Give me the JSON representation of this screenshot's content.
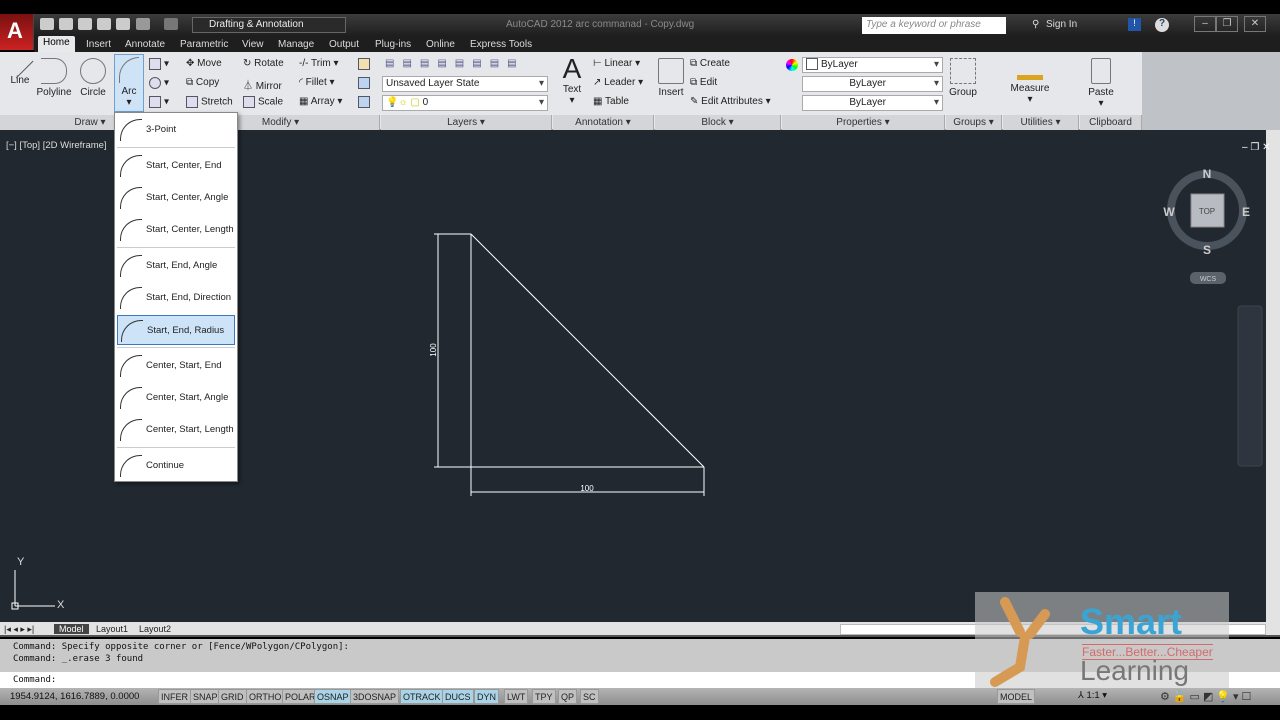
{
  "title_bar": {
    "app_title": "AutoCAD 2012   arc commanad - Copy.dwg",
    "workspace": "Drafting & Annotation",
    "search_placeholder": "Type a keyword or phrase",
    "sign_in": "Sign In",
    "help": "?"
  },
  "tabs": [
    "Home",
    "Insert",
    "Annotate",
    "Parametric",
    "View",
    "Manage",
    "Output",
    "Plug-ins",
    "Online",
    "Express Tools"
  ],
  "ribbon": {
    "draw": {
      "label": "Draw",
      "line": "Line",
      "polyline": "Polyline",
      "circle": "Circle",
      "arc": "Arc"
    },
    "modify": {
      "label": "Modify",
      "move": "Move",
      "rotate": "Rotate",
      "trim": "Trim",
      "copy": "Copy",
      "mirror": "Mirror",
      "fillet": "Fillet",
      "stretch": "Stretch",
      "scale": "Scale",
      "array": "Array"
    },
    "layers": {
      "label": "Layers",
      "layer_state": "Unsaved Layer State",
      "current_layer": "0"
    },
    "annotation": {
      "label": "Annotation",
      "text": "Text",
      "linear": "Linear",
      "leader": "Leader",
      "table": "Table"
    },
    "block": {
      "label": "Block",
      "insert": "Insert",
      "create": "Create",
      "edit": "Edit",
      "edit_attributes": "Edit Attributes"
    },
    "properties": {
      "label": "Properties",
      "color": "ByLayer",
      "lineweight": "ByLayer",
      "linetype": "ByLayer"
    },
    "groups": {
      "label": "Groups",
      "group": "Group"
    },
    "utilities": {
      "label": "Utilities",
      "measure": "Measure"
    },
    "clipboard": {
      "label": "Clipboard",
      "paste": "Paste"
    }
  },
  "arc_menu": {
    "items": [
      "3-Point",
      "Start, Center, End",
      "Start, Center, Angle",
      "Start, Center, Length",
      "Start, End, Angle",
      "Start, End, Direction",
      "Start, End, Radius",
      "Center, Start, End",
      "Center, Start, Angle",
      "Center, Start, Length",
      "Continue"
    ],
    "selected": "Start, End, Radius"
  },
  "viewport": {
    "label": "[−] [Top] [2D Wireframe]",
    "dim_vertical": "100",
    "dim_horizontal": "100",
    "ucs_x": "X",
    "ucs_y": "Y"
  },
  "viewcube": {
    "n": "N",
    "s": "S",
    "e": "E",
    "w": "W",
    "face": "TOP",
    "wcs": "WCS"
  },
  "layout_tabs": [
    "Model",
    "Layout1",
    "Layout2"
  ],
  "command_history": [
    "Command: Specify opposite corner or [Fence/WPolygon/CPolygon]:",
    "Command: _.erase 3 found"
  ],
  "command_prompt": "Command:",
  "status": {
    "coords": "1954.9124, 1616.7889, 0.0000",
    "toggles": [
      {
        "label": "INFER",
        "on": false
      },
      {
        "label": "SNAP",
        "on": false
      },
      {
        "label": "GRID",
        "on": false
      },
      {
        "label": "ORTHO",
        "on": false
      },
      {
        "label": "POLAR",
        "on": false
      },
      {
        "label": "OSNAP",
        "on": true
      },
      {
        "label": "3DOSNAP",
        "on": false
      },
      {
        "label": "OTRACK",
        "on": true
      },
      {
        "label": "DUCS",
        "on": true
      },
      {
        "label": "DYN",
        "on": true
      },
      {
        "label": "LWT",
        "on": false
      },
      {
        "label": "TPY",
        "on": false
      },
      {
        "label": "QP",
        "on": false
      },
      {
        "label": "SC",
        "on": false
      }
    ],
    "model": "MODEL",
    "scale": "1:1"
  },
  "watermark": {
    "brand": "Smart",
    "tagline": "Faster...Better...Cheaper",
    "word": "Learning"
  }
}
